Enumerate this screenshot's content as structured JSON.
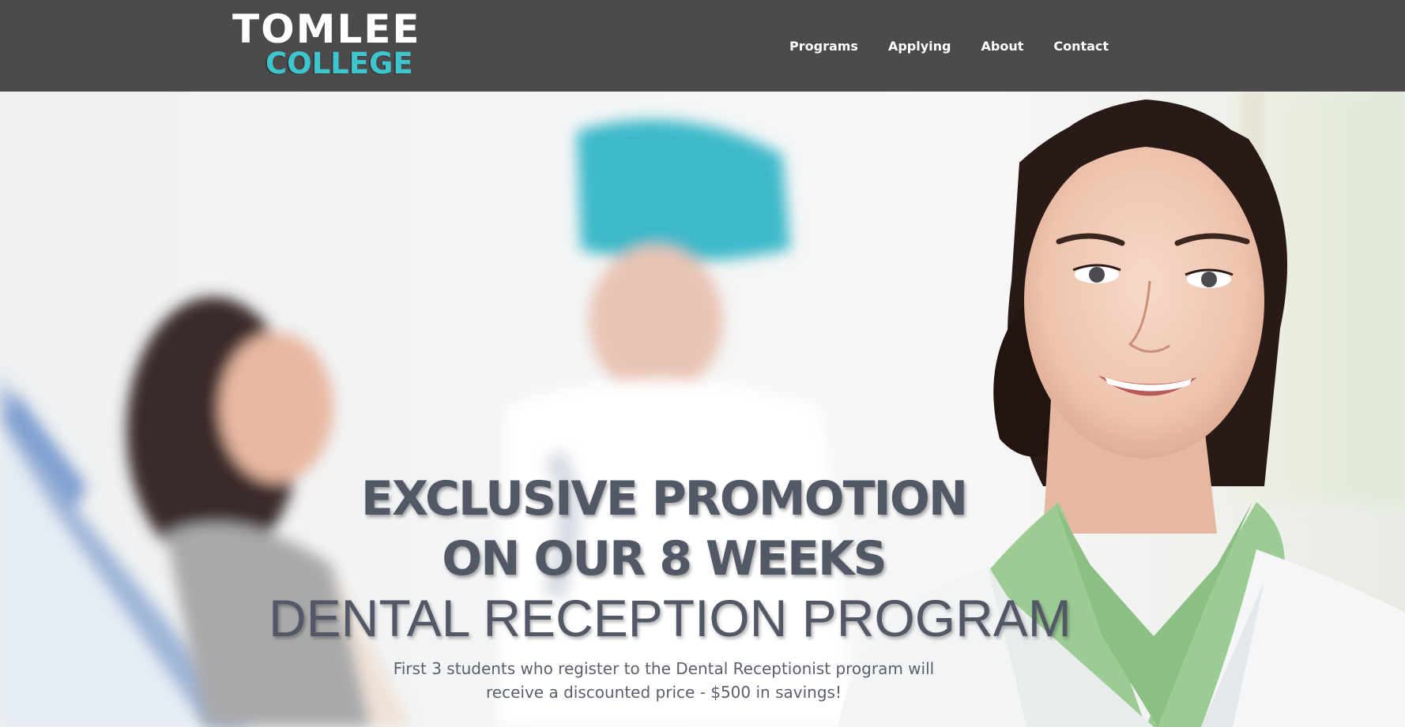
{
  "header": {
    "logo": {
      "line1": "TOMLEE",
      "line2": "COLLEGE"
    },
    "nav": [
      {
        "label": "Programs"
      },
      {
        "label": "Applying"
      },
      {
        "label": "About"
      },
      {
        "label": "Contact"
      }
    ]
  },
  "hero": {
    "headline_line1": "EXCLUSIVE PROMOTION",
    "headline_line2": "ON OUR 8 WEEKS",
    "headline_line3": "DENTAL RECEPTION PROGRAM",
    "subtext": "First 3 students who register to the Dental Receptionist program will receive a discounted price - $500 in savings!"
  },
  "colors": {
    "header_bg": "#4c4a4a",
    "logo_accent": "#3ec6cf",
    "headline": "#535866"
  }
}
